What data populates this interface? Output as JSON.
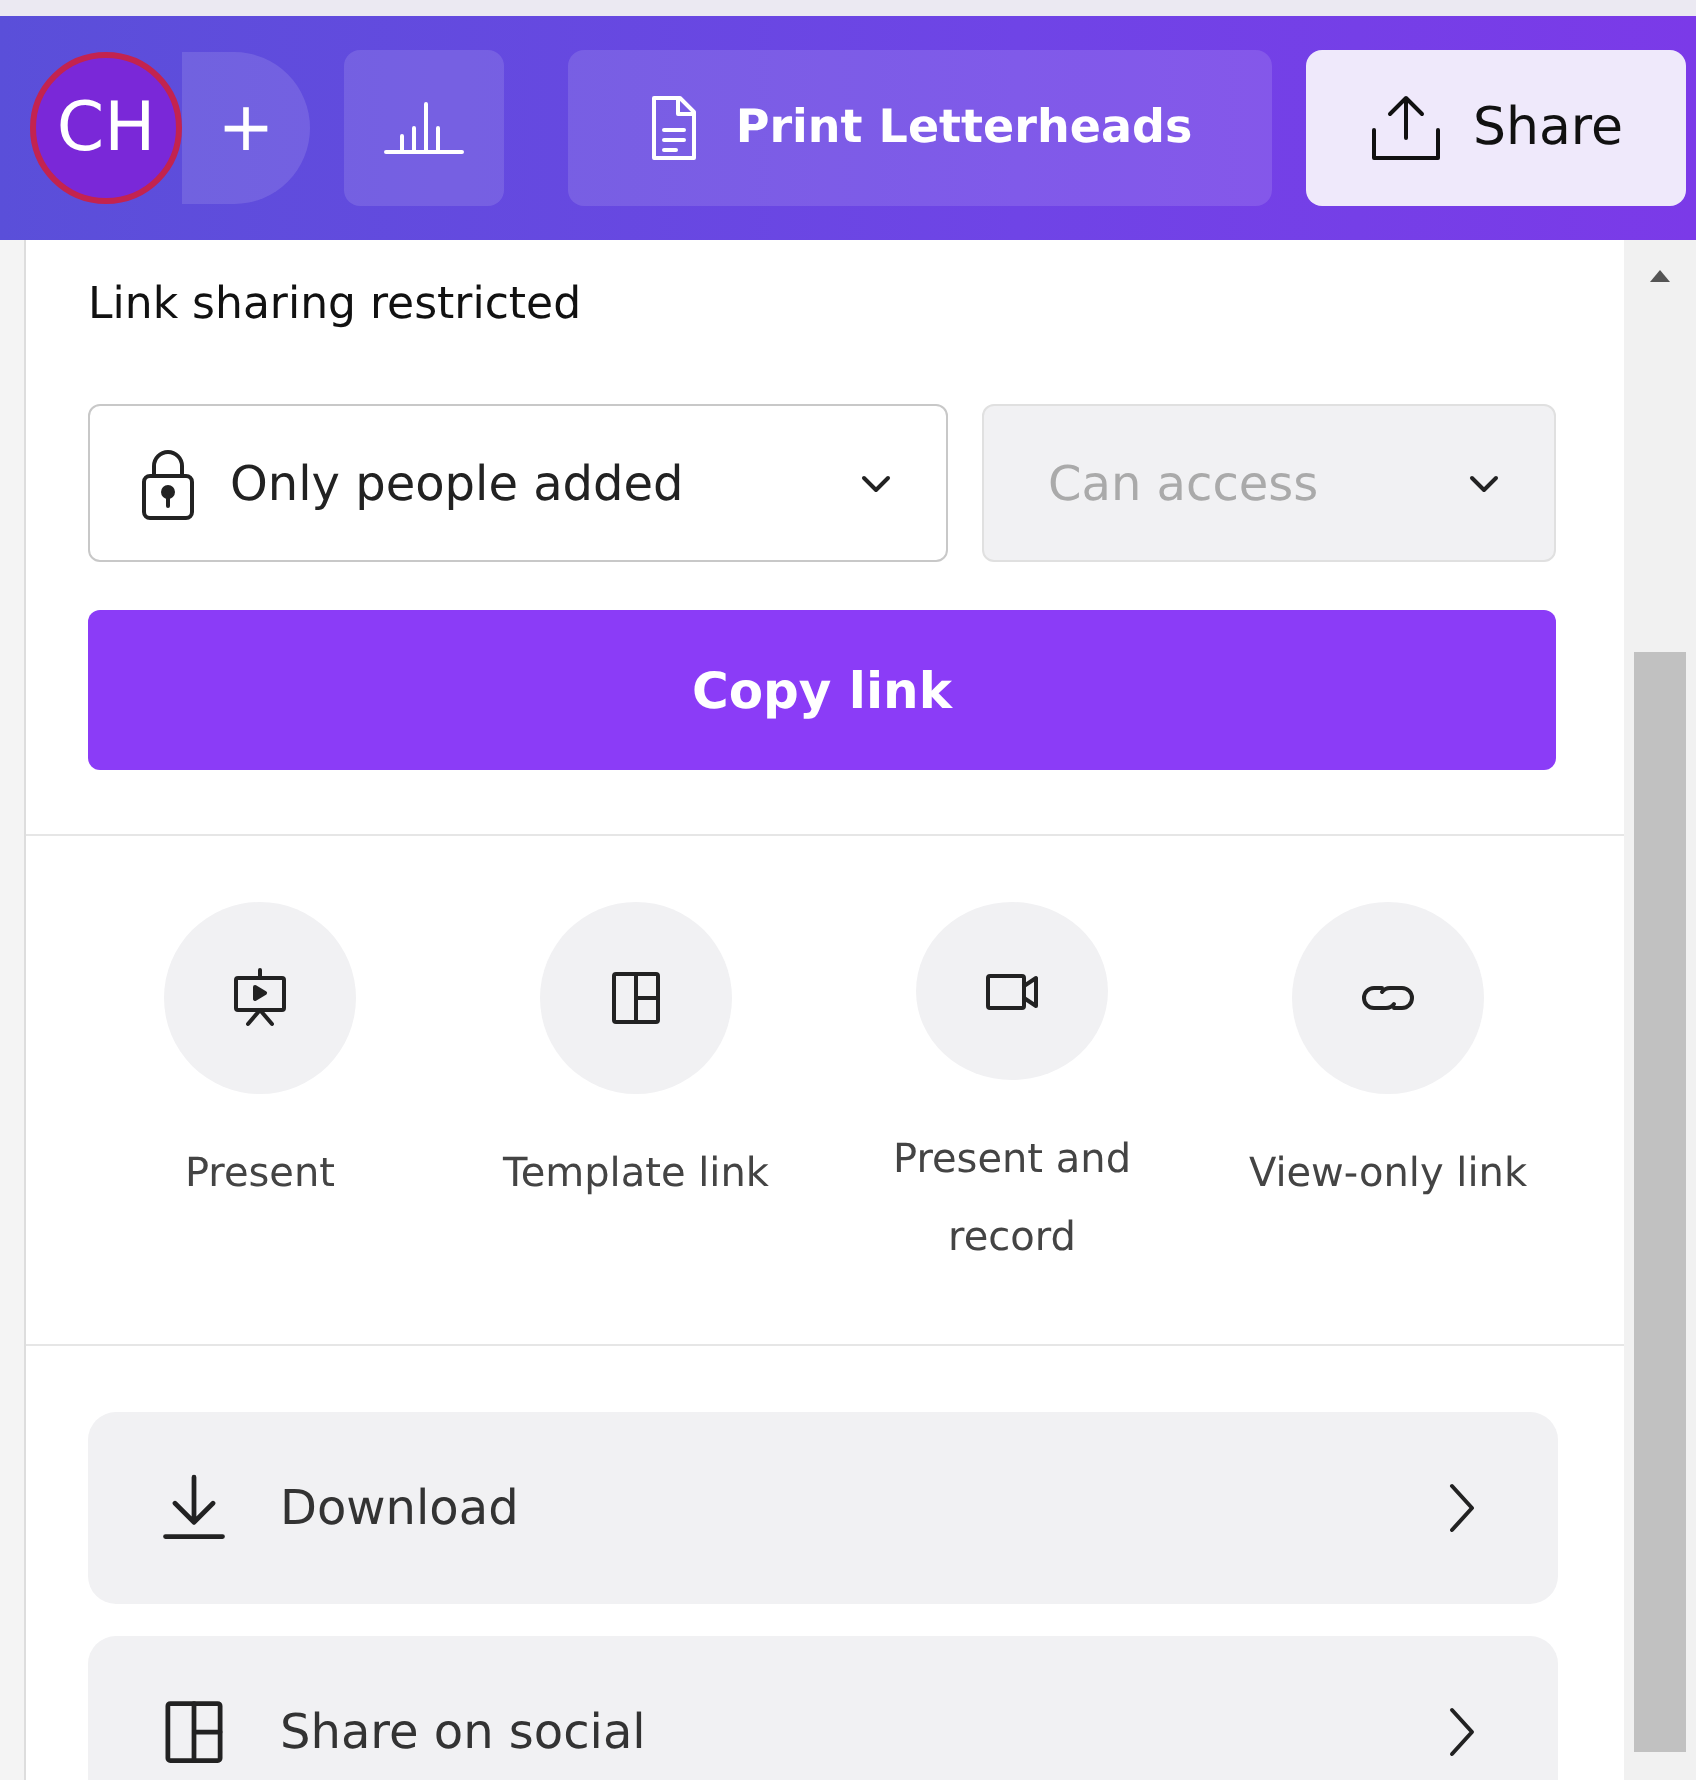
{
  "toolbar": {
    "avatar": "CH",
    "add": "+",
    "title_button": "Print Letterheads",
    "share_button": "Share"
  },
  "panel": {
    "heading": "Link sharing restricted",
    "access": {
      "value": "Only people added",
      "disabled": false
    },
    "permission": {
      "value": "Can access",
      "disabled": true
    },
    "copy_button": "Copy link",
    "actions": [
      {
        "kind": "present",
        "label": "Present"
      },
      {
        "kind": "template",
        "label": "Template link"
      },
      {
        "kind": "record",
        "label": "Present and record"
      },
      {
        "kind": "link",
        "label": "View-only link"
      }
    ],
    "rows": [
      {
        "kind": "download",
        "label": "Download"
      },
      {
        "kind": "social",
        "label": "Share on social"
      }
    ]
  }
}
